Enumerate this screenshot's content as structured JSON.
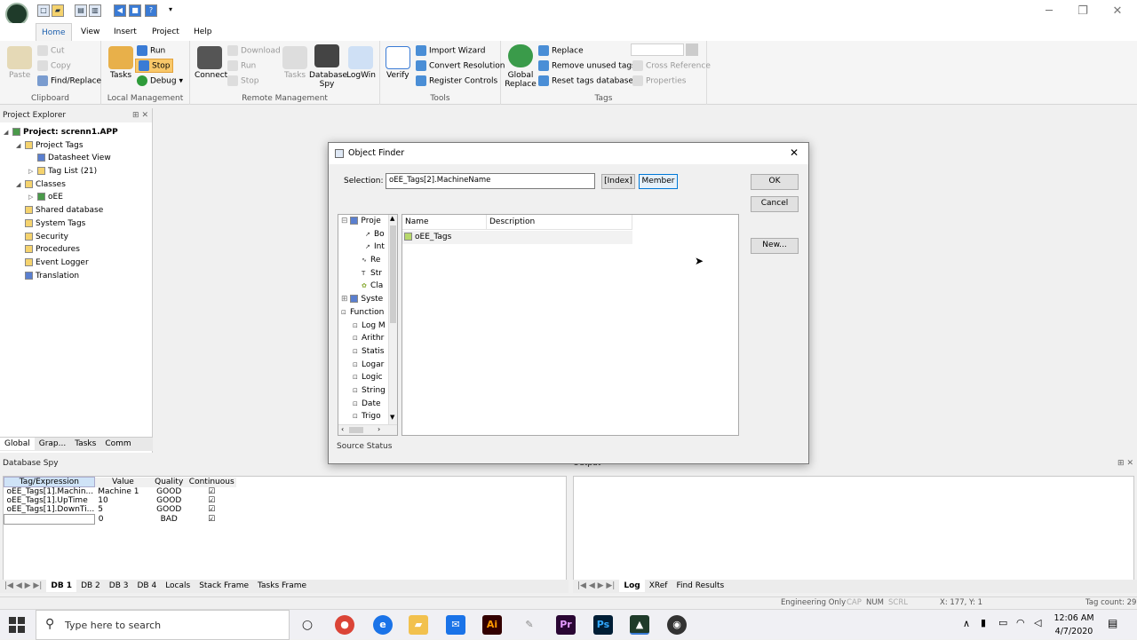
{
  "app": {
    "title_icons": [
      "app-logo-icon"
    ]
  },
  "menu": [
    "Home",
    "View",
    "Insert",
    "Project",
    "Help"
  ],
  "ribbon": {
    "clipboard": {
      "paste": "Paste",
      "cut": "Cut",
      "copy": "Copy",
      "find": "Find/Replace",
      "label": "Clipboard"
    },
    "local": {
      "tasks": "Tasks",
      "run": "Run",
      "stop": "Stop",
      "debug": "Debug",
      "label": "Local Management"
    },
    "remote": {
      "connect": "Connect",
      "download": "Download",
      "run": "Run",
      "stop": "Stop",
      "tasks": "Tasks",
      "dbspy": "Database Spy",
      "logwin": "LogWin",
      "label": "Remote Management"
    },
    "tools": {
      "verify": "Verify",
      "import": "Import Wizard",
      "convert": "Convert Resolution",
      "register": "Register Controls",
      "label": "Tools"
    },
    "tags": {
      "global": "Global Replace",
      "replace": "Replace",
      "remove": "Remove unused tags",
      "reset": "Reset tags database",
      "xref": "Cross Reference",
      "props": "Properties",
      "label": "Tags"
    }
  },
  "explorer": {
    "title": "Project Explorer",
    "items": [
      "Project: screnn1.APP",
      "Project Tags",
      "Datasheet View",
      "Tag List (21)",
      "Classes",
      "oEE",
      "Shared database",
      "System Tags",
      "Security",
      "Procedures",
      "Event Logger",
      "Translation"
    ],
    "tabs": [
      "Global",
      "Grap...",
      "Tasks",
      "Comm"
    ]
  },
  "dbspy": {
    "title": "Database Spy",
    "headers": [
      "Tag/Expression",
      "Value",
      "Quality",
      "Continuous"
    ],
    "rows": [
      [
        "oEE_Tags[1].Machin...",
        "Machine 1",
        "GOOD"
      ],
      [
        "oEE_Tags[1].UpTime",
        "10",
        "GOOD"
      ],
      [
        "oEE_Tags[1].DownTi...",
        "5",
        "GOOD"
      ],
      [
        "",
        "0",
        "BAD"
      ]
    ],
    "tabs": [
      "DB 1",
      "DB 2",
      "DB 3",
      "DB 4",
      "Locals",
      "Stack Frame",
      "Tasks Frame"
    ]
  },
  "output": {
    "title": "Output",
    "tabs": [
      "Log",
      "XRef",
      "Find Results"
    ]
  },
  "dialog": {
    "title": "Object Finder",
    "selection_label": "Selection:",
    "selection_value": "oEE_Tags[2].MachineName",
    "index_btn": "[Index]",
    "member_btn": "Member",
    "ok": "OK",
    "cancel": "Cancel",
    "new": "New...",
    "tree": [
      "Proje",
      "Bo",
      "Int",
      "Re",
      "Str",
      "Cla",
      "Syste",
      "Function",
      "Log M",
      "Arithr",
      "Statis",
      "Logar",
      "Logic",
      "String",
      "Date",
      "Trigo"
    ],
    "col_name": "Name",
    "col_desc": "Description",
    "item": "oEE_Tags",
    "source_status": "Source Status"
  },
  "status": {
    "eng": "Engineering Only",
    "caps": "CAP",
    "num": "NUM",
    "scrl": "SCRL",
    "coords": "X: 177, Y: 1",
    "tagcount": "Tag count: 29"
  },
  "taskbar": {
    "search": "Type here to search",
    "time": "12:06 AM",
    "date": "4/7/2020"
  }
}
